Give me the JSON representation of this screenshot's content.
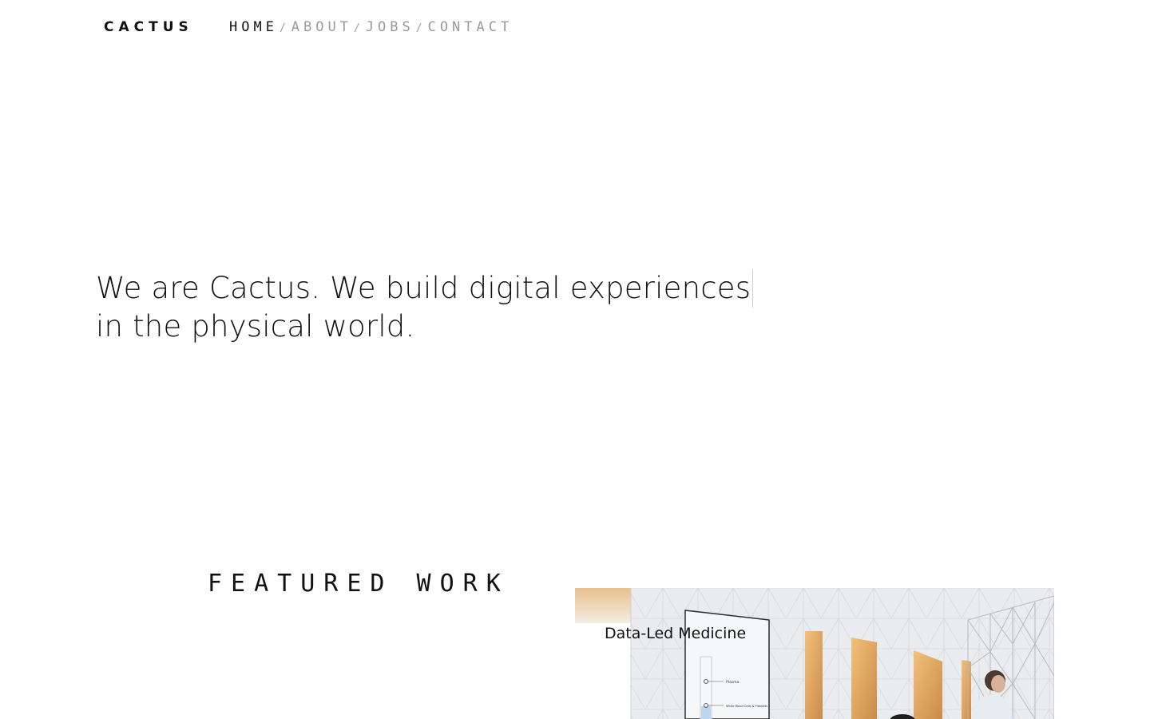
{
  "header": {
    "logo": "CACTUS",
    "nav": [
      {
        "label": "HOME",
        "active": true
      },
      {
        "label": "ABOUT",
        "active": false
      },
      {
        "label": "JOBS",
        "active": false
      },
      {
        "label": "CONTACT",
        "active": false
      }
    ],
    "separator": "/"
  },
  "hero": {
    "line1": "We are Cactus. We build digital experiences",
    "line2": "in the physical world."
  },
  "featured": {
    "heading": "FEATURED WORK",
    "projects": [
      {
        "title": "Data-Led Medicine",
        "image": "exhibition-room-photo",
        "screen_labels": [
          "Plasma",
          "White Blood Cells & Platelets"
        ]
      }
    ]
  },
  "colors": {
    "text": "#111111",
    "nav_inactive": "#9a9a9a",
    "background": "#ffffff",
    "wood_accent": "#d9a466"
  }
}
